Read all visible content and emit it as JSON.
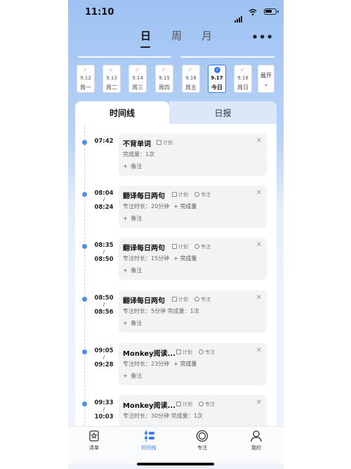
{
  "status_bar": {
    "time": "11:10"
  },
  "view_modes": [
    {
      "label": "日",
      "active": true
    },
    {
      "label": "周",
      "active": false
    },
    {
      "label": "月",
      "active": false
    }
  ],
  "more_menu": "•••",
  "week": [
    {
      "date": "9.12",
      "weekday": "周一",
      "checked": true
    },
    {
      "date": "9.13",
      "weekday": "周二",
      "checked": true
    },
    {
      "date": "9.14",
      "weekday": "周三",
      "checked": true
    },
    {
      "date": "9.15",
      "weekday": "周四",
      "checked": true
    },
    {
      "date": "9.16",
      "weekday": "周五",
      "checked": true
    },
    {
      "date": "9.17",
      "weekday": "今日",
      "checked": true,
      "today": true
    },
    {
      "date": "9.18",
      "weekday": "周日",
      "checked": true
    }
  ],
  "expand": {
    "label": "展开",
    "chevron": "⌄"
  },
  "tabs": {
    "timeline": "时间线",
    "daily_report": "日报"
  },
  "entries": [
    {
      "start": "07:42",
      "end": "",
      "title": "不背单词",
      "plan_tag": "计划",
      "focus_tag": "",
      "detail": "完成量：1次",
      "detail_add": "",
      "note": "备注"
    },
    {
      "start": "08:04",
      "end": "08:24",
      "title": "翻译每日两句",
      "plan_tag": "计划",
      "focus_tag": "专注",
      "detail": "专注时长：20分钟",
      "detail_add": "完成量",
      "note": "备注"
    },
    {
      "start": "08:35",
      "end": "08:50",
      "title": "翻译每日两句",
      "plan_tag": "计划",
      "focus_tag": "专注",
      "detail": "专注时长：15分钟",
      "detail_add": "完成量",
      "note": "备注"
    },
    {
      "start": "08:50",
      "end": "08:56",
      "title": "翻译每日两句",
      "plan_tag": "计划",
      "focus_tag": "专注",
      "detail": "专注时长：5分钟  完成量：1次",
      "detail_add": "",
      "note": "备注"
    },
    {
      "start": "09:05",
      "end": "09:28",
      "title": "Monkey阅读...",
      "plan_tag": "计划",
      "focus_tag": "专注",
      "detail": "专注时长：23分钟",
      "detail_add": "完成量",
      "note": "备注"
    },
    {
      "start": "09:33",
      "end": "10:03",
      "title": "Monkey阅读...",
      "plan_tag": "计划",
      "focus_tag": "专注",
      "detail": "专注时长：30分钟  完成量：1次",
      "detail_add": "",
      "note": ""
    }
  ],
  "tab_bar": [
    {
      "label": "清单",
      "icon": "checklist-icon",
      "active": false
    },
    {
      "label": "时间线",
      "icon": "timeline-icon",
      "active": true
    },
    {
      "label": "专注",
      "icon": "focus-icon",
      "active": false
    },
    {
      "label": "我的",
      "icon": "profile-icon",
      "active": false
    }
  ],
  "colors": {
    "accent": "#3a7bf0",
    "timeline_dot": "#4a8ef3",
    "card_bg": "#f2f3f5"
  }
}
